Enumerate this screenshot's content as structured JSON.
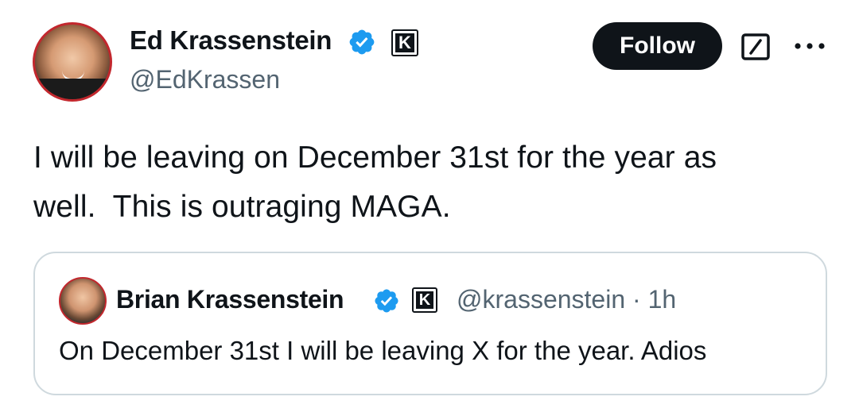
{
  "tweet": {
    "author": {
      "name": "Ed Krassenstein",
      "handle": "@EdKrassen",
      "avatar_icon": "profile-photo",
      "verified_icon": "verified-badge-icon",
      "affiliate_badge": "K"
    },
    "follow_label": "Follow",
    "actions": {
      "grok_icon": "grok-icon",
      "more_icon": "more-options-icon"
    },
    "text_lines": [
      "I will be leaving on December 31st for the year as",
      "well.  This is outraging MAGA."
    ]
  },
  "quote": {
    "author": {
      "name": "Brian Krassenstein",
      "handle": "@krassenstein",
      "affiliate_badge": "K"
    },
    "separator": "·",
    "time": "1h",
    "text": "On December 31st I will be leaving X for the year. Adios"
  },
  "colors": {
    "text": "#0f1419",
    "muted": "#536471",
    "verified": "#1d9bf0",
    "follow_bg": "#0f1419",
    "border": "#cfd9de",
    "avatar_ring": "#c2272d"
  }
}
